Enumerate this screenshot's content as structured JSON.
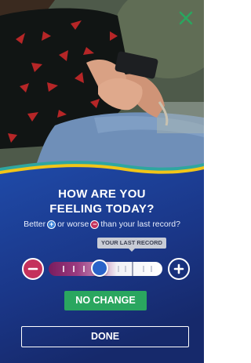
{
  "header": {
    "close_icon": "close-icon",
    "close_color": "#2aa65f"
  },
  "prompt": {
    "title_line1": "HOW ARE YOU",
    "title_line2": "FEELING TODAY?",
    "sub_before": "Better",
    "sub_middle": "or worse",
    "sub_after": "than your last record?",
    "plus_glyph": "+",
    "minus_glyph": "−"
  },
  "slider": {
    "record_tag_label": "YOUR LAST RECORD",
    "minus_icon": "minus-icon",
    "plus_icon": "plus-icon",
    "thumb_position": 0.45,
    "last_record_position": 0.74
  },
  "actions": {
    "no_change_label": "NO CHANGE",
    "done_label": "DONE"
  },
  "colors": {
    "panel_blue": "#1c3a8f",
    "accent_green": "#2aa65f",
    "minus_red": "#c4325c",
    "thumb_blue": "#2a63c9",
    "wave_yellow": "#f2c518",
    "wave_teal": "#2fa6a0"
  }
}
